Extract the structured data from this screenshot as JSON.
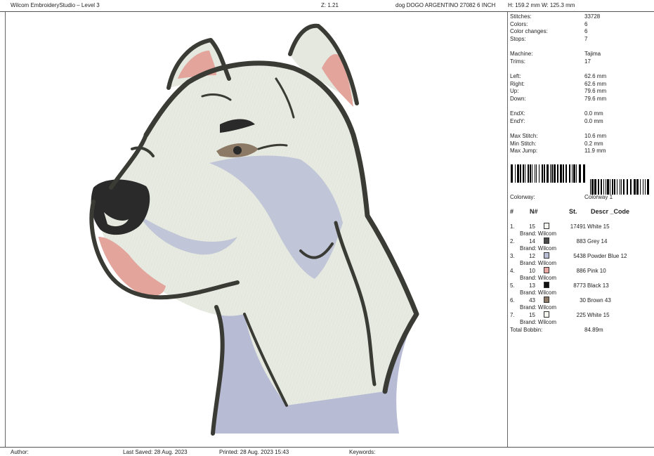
{
  "header": {
    "app_title": "Wilcom EmbroideryStudio – Level 3",
    "zoom": "Z: 1.21",
    "design_name": "dog DOGO ARGENTINO 27082 6 INCH",
    "size": "H: 159.2 mm   W: 125.3 mm"
  },
  "stats": [
    {
      "label": "Stitches:",
      "value": "33728"
    },
    {
      "label": "Colors:",
      "value": "6"
    },
    {
      "label": "Color changes:",
      "value": "6"
    },
    {
      "label": "Stops:",
      "value": "7"
    },
    {
      "label": "Machine:",
      "value": "Tajima"
    },
    {
      "label": "Trims:",
      "value": "17"
    },
    {
      "label": "Left:",
      "value": "62.6 mm"
    },
    {
      "label": "Right:",
      "value": "62.6 mm"
    },
    {
      "label": "Up:",
      "value": "79.6 mm"
    },
    {
      "label": "Down:",
      "value": "79.6 mm"
    },
    {
      "label": "EndX:",
      "value": "0.0 mm"
    },
    {
      "label": "EndY:",
      "value": "0.0 mm"
    },
    {
      "label": "Max Stitch:",
      "value": "10.6 mm"
    },
    {
      "label": "Min Stitch:",
      "value": "0.2 mm"
    },
    {
      "label": "Max Jump:",
      "value": "11.9 mm"
    }
  ],
  "colorway": {
    "label": "Colorway:",
    "value": "Colorway 1"
  },
  "table": {
    "headers": {
      "num": "#",
      "n": "N#",
      "st": "St.",
      "desc": "Descr _Code"
    },
    "rows": [
      {
        "num": "1.",
        "n": "15",
        "color": "#f4f5ee",
        "stitches": "17491",
        "desc": "White 15",
        "brand": "Brand: Wilcom"
      },
      {
        "num": "2.",
        "n": "14",
        "color": "#4a4a4a",
        "stitches": "883",
        "desc": "Grey 14",
        "brand": "Brand: Wilcom"
      },
      {
        "num": "3.",
        "n": "12",
        "color": "#b9bdd6",
        "stitches": "5438",
        "desc": "Powder Blue 12",
        "brand": "Brand: Wilcom"
      },
      {
        "num": "4.",
        "n": "10",
        "color": "#e8a7a0",
        "stitches": "886",
        "desc": "Pink 10",
        "brand": "Brand: Wilcom"
      },
      {
        "num": "5.",
        "n": "13",
        "color": "#111111",
        "stitches": "8773",
        "desc": "Black 13",
        "brand": "Brand: Wilcom"
      },
      {
        "num": "6.",
        "n": "43",
        "color": "#8c7a66",
        "stitches": "30",
        "desc": "Brown 43",
        "brand": "Brand: Wilcom"
      },
      {
        "num": "7.",
        "n": "15",
        "color": "#f4f5ee",
        "stitches": "225",
        "desc": "White 15",
        "brand": "Brand: Wilcom"
      }
    ]
  },
  "total_bobbin": {
    "label": "Total Bobbin:",
    "value": "84.89m"
  },
  "footer": {
    "author": "Author:",
    "last_saved": "Last Saved: 28 Aug. 2023",
    "printed": "Printed: 28 Aug. 2023 15:43",
    "keywords": "Keywords:"
  },
  "colors": {
    "outline": "#3b3b36",
    "face_white": "#e4e8de",
    "powder_blue": "#b7bbd4",
    "pink": "#e3a49c",
    "black": "#2a2a2a"
  }
}
